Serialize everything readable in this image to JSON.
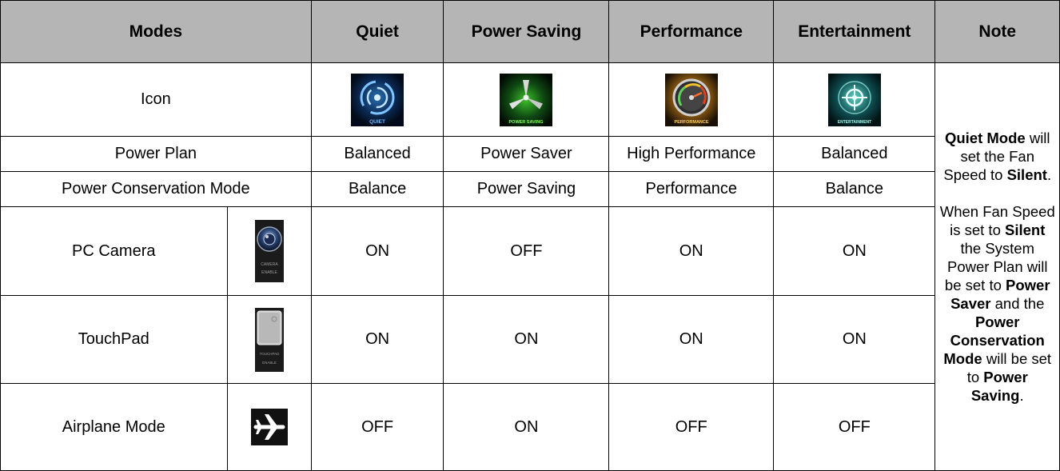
{
  "header": {
    "modes": "Modes",
    "quiet": "Quiet",
    "power_saving": "Power Saving",
    "performance": "Performance",
    "entertainment": "Entertainment",
    "note": "Note"
  },
  "rows": {
    "icon": {
      "label": "Icon",
      "quiet_icon_text": "QUIET",
      "power_saving_icon_text": "POWER SAVING",
      "performance_icon_text": "PERFORMANCE",
      "entertainment_icon_text": "ENTERTAINMENT"
    },
    "power_plan": {
      "label": "Power Plan",
      "quiet": "Balanced",
      "power_saving": "Power Saver",
      "performance": "High Performance",
      "entertainment": "Balanced"
    },
    "power_conservation": {
      "label": "Power Conservation Mode",
      "quiet": "Balance",
      "power_saving": "Power Saving",
      "performance": "Performance",
      "entertainment": "Balance"
    },
    "pc_camera": {
      "label": "PC Camera",
      "icon_text_1": "CAMERA",
      "icon_text_2": "ENABLE",
      "quiet": "ON",
      "power_saving": "OFF",
      "performance": "ON",
      "entertainment": "ON"
    },
    "touchpad": {
      "label": "TouchPad",
      "icon_text_1": "TOUCHPAD",
      "icon_text_2": "ENABLE",
      "quiet": "ON",
      "power_saving": "ON",
      "performance": "ON",
      "entertainment": "ON"
    },
    "airplane": {
      "label": "Airplane Mode",
      "quiet": "OFF",
      "power_saving": "ON",
      "performance": "OFF",
      "entertainment": "OFF"
    }
  },
  "note": {
    "p1_b1": "Quiet Mode",
    "p1_t1": " will set the Fan Speed to ",
    "p1_b2": "Silent",
    "p1_t2": ".",
    "p2_t1": "When Fan Speed is set to ",
    "p2_b1": "Silent",
    "p2_t2": " the System Power Plan will be set to ",
    "p2_b2": "Power Saver",
    "p2_t3": " and the ",
    "p2_b3": "Power Conservation Mode",
    "p2_t4": " will be set to ",
    "p2_b4": "Power Saving",
    "p2_t5": "."
  },
  "colors": {
    "header_bg": "#b5b5b5",
    "border": "#000000"
  }
}
